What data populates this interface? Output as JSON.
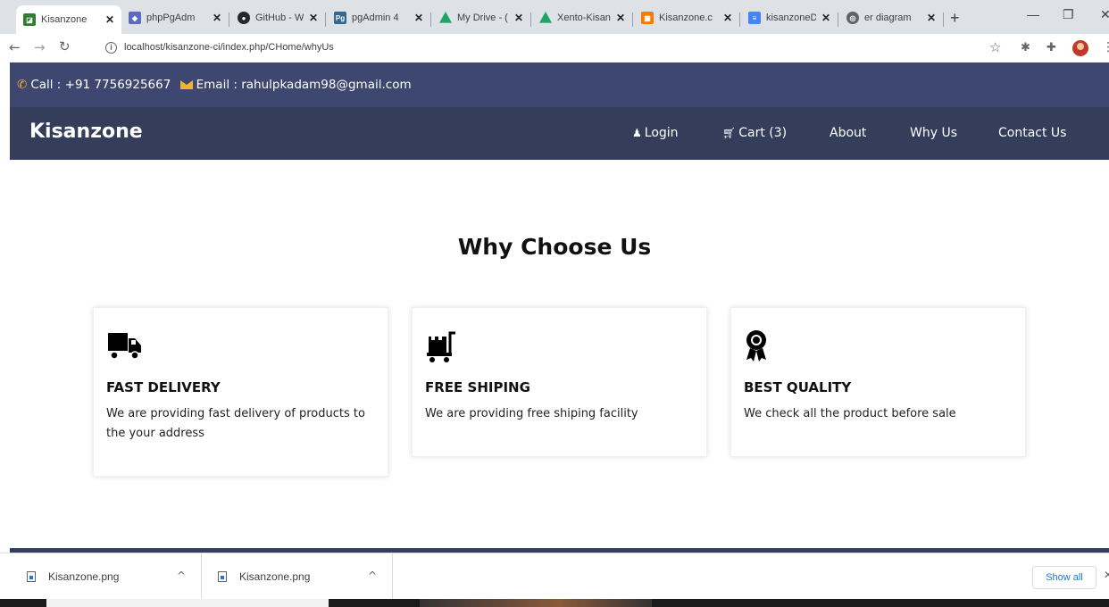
{
  "browser": {
    "tabs": [
      {
        "label": "Kisanzone",
        "favicon_color": "#2e7d32"
      },
      {
        "label": "phpPgAdm",
        "favicon_color": "#5c6bc0"
      },
      {
        "label": "GitHub - W",
        "favicon_color": "#24292e"
      },
      {
        "label": "pgAdmin 4",
        "favicon_color": "#336791"
      },
      {
        "label": "My Drive - (",
        "favicon_color": "#1fa463"
      },
      {
        "label": "Xento-Kisan",
        "favicon_color": "#1fa463"
      },
      {
        "label": "Kisanzone.c",
        "favicon_color": "#f57c00"
      },
      {
        "label": "kisanzoneD",
        "favicon_color": "#4285f4"
      },
      {
        "label": "er diagram",
        "favicon_color": "#5f6368"
      }
    ],
    "url": "localhost/kisanzone-ci/index.php/CHome/whyUs"
  },
  "topbar": {
    "call": "Call : +91 7756925667",
    "email": "Email : rahulpkadam98@gmail.com"
  },
  "navbar": {
    "brand": "Kisanzone",
    "login": "Login",
    "cart": "Cart (3)",
    "about": "About",
    "why_us": "Why Us",
    "contact": "Contact Us"
  },
  "main": {
    "title": "Why Choose Us",
    "features": [
      {
        "title": "FAST DELIVERY",
        "text": "We are providing fast delivery of products to the your address",
        "icon": "truck-icon"
      },
      {
        "title": "FREE SHIPING",
        "text": "We are providing free shiping facility",
        "icon": "dolly-icon"
      },
      {
        "title": "BEST QUALITY",
        "text": "We check all the product before sale",
        "icon": "award-icon"
      }
    ]
  },
  "downloads": {
    "files": [
      "Kisanzone.png",
      "Kisanzone.png"
    ],
    "show_all": "Show all"
  },
  "colors": {
    "topbar": "#3e4770",
    "navbar": "#343e5b",
    "accent": "#f0b430"
  }
}
